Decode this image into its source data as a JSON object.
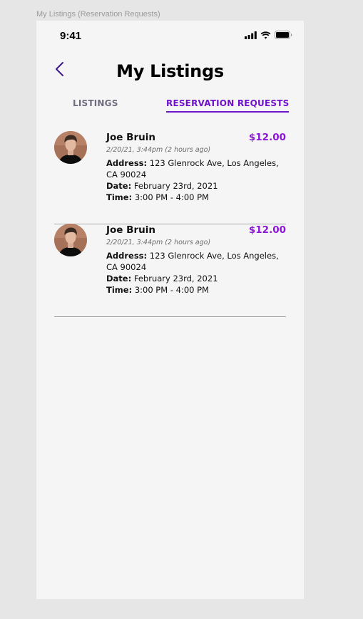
{
  "frame_label": "My Listings (Reservation Requests)",
  "status_bar": {
    "time": "9:41",
    "icons": [
      "signal-icon",
      "wifi-icon",
      "battery-icon"
    ]
  },
  "header": {
    "back_icon": "chevron-left-icon",
    "title": "My Listings"
  },
  "tabs": [
    {
      "label": "LISTINGS",
      "active": false
    },
    {
      "label": "RESERVATION REQUESTS",
      "active": true
    }
  ],
  "requests": [
    {
      "name": "Joe Bruin",
      "price": "$12.00",
      "timestamp": "2/20/21, 3:44pm (2 hours ago)",
      "address_label": "Address:",
      "address": " 123 Glenrock Ave, Los Angeles, CA 90024",
      "date_label": "Date:",
      "date": " February 23rd, 2021",
      "time_label": "Time:",
      "time": " 3:00 PM - 4:00 PM"
    },
    {
      "name": "Joe Bruin",
      "price": "$12.00",
      "timestamp": "2/20/21, 3:44pm (2 hours ago)",
      "address_label": "Address:",
      "address": " 123 Glenrock Ave, Los Angeles, CA 90024",
      "date_label": "Date:",
      "date": " February 23rd, 2021",
      "time_label": "Time:",
      "time": " 3:00 PM - 4:00 PM"
    }
  ],
  "colors": {
    "accent": "#7012cc",
    "price": "#8c17d6",
    "inactive_tab": "#6f6a7d",
    "divider": "#a9a9a9",
    "background": "#f5f5f5"
  }
}
